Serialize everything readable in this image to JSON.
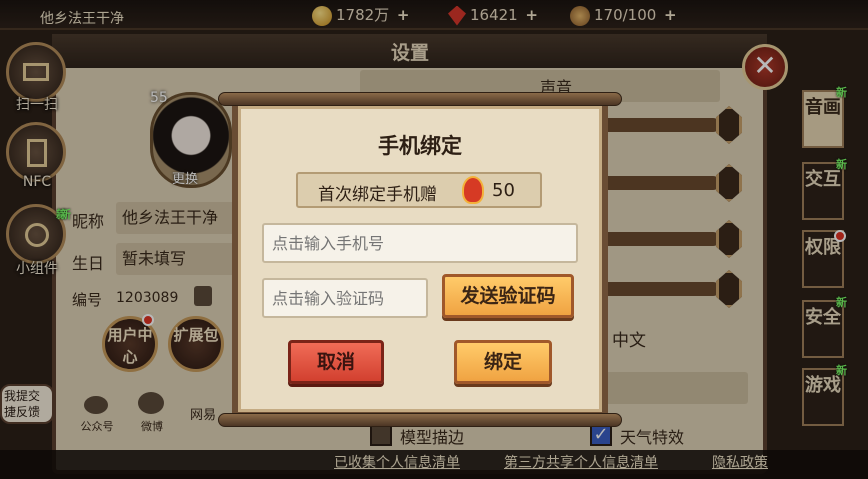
{
  "topbar": {
    "player_name": "他乡法王干净",
    "gold": "1782万",
    "gems": "16421",
    "stamina": "170/100"
  },
  "settings": {
    "title": "设置",
    "close_icon": "close-icon",
    "left_buttons": [
      {
        "label": "扫一扫",
        "icon": "scan-icon"
      },
      {
        "label": "NFC",
        "icon": "nfc-icon"
      },
      {
        "label": "小组件",
        "icon": "widget-icon",
        "badge": "新"
      }
    ],
    "avatar": {
      "level": "55",
      "change_label": "更换"
    },
    "profile": {
      "nickname_label": "昵称",
      "nickname": "他乡法王干净",
      "birthday_label": "生日",
      "birthday": "暂未填写",
      "id_label": "编号",
      "id_value": "1203089",
      "new_badge": "新"
    },
    "round_buttons": [
      {
        "label": "用户中心"
      },
      {
        "label": "扩展包"
      }
    ],
    "social": [
      {
        "label": "公众号"
      },
      {
        "label": "微博"
      },
      {
        "label": "网易"
      }
    ],
    "feedback": "我提交捷反馈",
    "right_panel": {
      "sound_header": "声音",
      "language": "中文",
      "checkbox_model_outline": "模型描边",
      "checkbox_weather": "天气特效"
    },
    "tabs": [
      {
        "label": "音画",
        "badge": "新",
        "active": true
      },
      {
        "label": "交互",
        "badge": "新"
      },
      {
        "label": "权限"
      },
      {
        "label": "安全",
        "badge": "新"
      },
      {
        "label": "游戏",
        "badge": "新"
      }
    ]
  },
  "bottom_links": [
    "已收集个人信息清单",
    "第三方共享个人信息清单",
    "隐私政策"
  ],
  "dialog": {
    "title": "手机绑定",
    "reward_text": "首次绑定手机赠",
    "reward_amount": "50",
    "phone_placeholder": "点击输入手机号",
    "code_placeholder": "点击输入验证码",
    "send_code_label": "发送验证码",
    "cancel_label": "取消",
    "bind_label": "绑定"
  }
}
